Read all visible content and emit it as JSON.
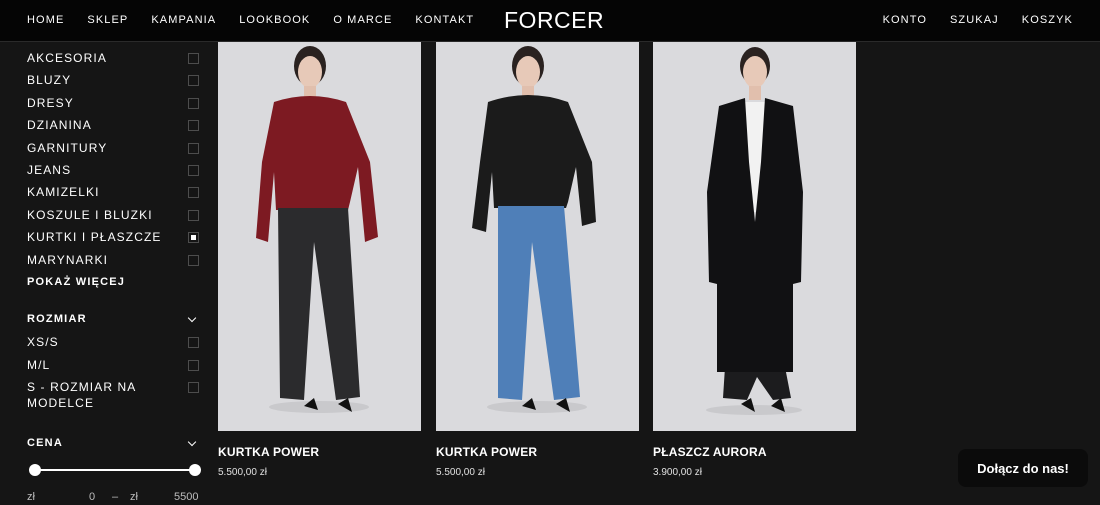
{
  "nav": {
    "left": [
      "HOME",
      "SKLEP",
      "KAMPANIA",
      "LOOKBOOK",
      "O MARCE",
      "KONTAKT"
    ],
    "right": [
      "KONTO",
      "SZUKAJ",
      "KOSZYK"
    ],
    "logo": "FORCER"
  },
  "categories": {
    "items": [
      {
        "label": "AKCESORIA",
        "checked": false
      },
      {
        "label": "BLUZY",
        "checked": false
      },
      {
        "label": "DRESY",
        "checked": false
      },
      {
        "label": "DZIANINA",
        "checked": false
      },
      {
        "label": "GARNITURY",
        "checked": false
      },
      {
        "label": "JEANS",
        "checked": false
      },
      {
        "label": "KAMIZELKI",
        "checked": false
      },
      {
        "label": "KOSZULE I BLUZKI",
        "checked": false
      },
      {
        "label": "KURTKI I PŁASZCZE",
        "checked": true
      },
      {
        "label": "MARYNARKI",
        "checked": false
      }
    ],
    "show_more": "POKAŻ WIĘCEJ"
  },
  "size_filter": {
    "title": "ROZMIAR",
    "items": [
      {
        "label": "XS/S",
        "checked": false
      },
      {
        "label": "M/L",
        "checked": false
      },
      {
        "label": "S - ROZMIAR NA MODELCE",
        "checked": false
      }
    ]
  },
  "price_filter": {
    "title": "CENA",
    "currency": "zł",
    "separator": "–",
    "min": "0",
    "max": "5500",
    "selected_min": 0,
    "selected_max": 5500
  },
  "products": [
    {
      "name": "KURTKA POWER",
      "price": "5.500,00 zł",
      "jacket_color": "#7d1a22",
      "pants_color": "#2b2b2d"
    },
    {
      "name": "KURTKA POWER",
      "price": "5.500,00 zł",
      "jacket_color": "#1b1b1b",
      "pants_color": "#4f7fb8"
    },
    {
      "name": "PŁASZCZ AURORA",
      "price": "3.900,00 zł",
      "jacket_color": "#111113",
      "pants_color": "#1c1c1e"
    }
  ],
  "chat": {
    "label": "Dołącz do nas!"
  },
  "colors": {
    "background": "#151515",
    "topbar": "#050505",
    "photo_bg": "#dadadd"
  }
}
